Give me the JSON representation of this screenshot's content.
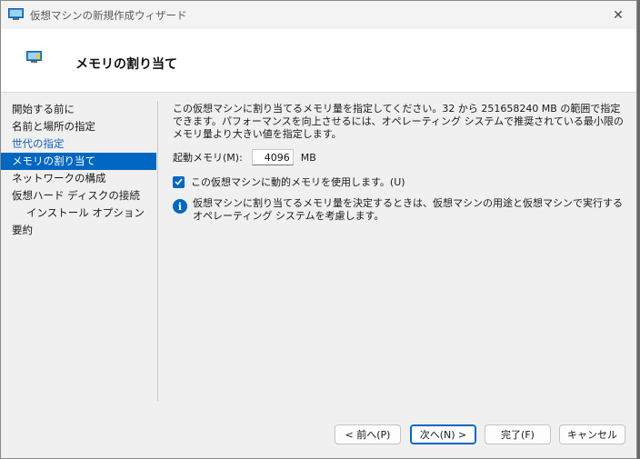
{
  "window": {
    "title": "仮想マシンの新規作成ウィザード",
    "close_glyph": "✕"
  },
  "header": {
    "title": "メモリの割り当て"
  },
  "nav": {
    "items": [
      {
        "label": "開始する前に"
      },
      {
        "label": "名前と場所の指定"
      },
      {
        "label": "世代の指定"
      },
      {
        "label": "メモリの割り当て"
      },
      {
        "label": "ネットワークの構成"
      },
      {
        "label": "仮想ハード ディスクの接続"
      },
      {
        "label": "インストール オプション"
      },
      {
        "label": "要約"
      }
    ],
    "active_index": 3
  },
  "main": {
    "description": "この仮想マシンに割り当てるメモリ量を指定してください。32 から 251658240 MB の範囲で指定できます。パフォーマンスを向上させるには、オペレーティング システムで推奨されている最小限のメモリ量より大きい値を指定します。",
    "startup_memory_label": "起動メモリ(M):",
    "startup_memory_value": "4096",
    "memory_unit": "MB",
    "dynamic_memory_label": "この仮想マシンに動的メモリを使用します。(U)",
    "dynamic_memory_checked": true,
    "info_text": "仮想マシンに割り当てるメモリ量を決定するときは、仮想マシンの用途と仮想マシンで実行するオペレーティング システムを考慮します。",
    "info_icon": "info-icon"
  },
  "buttons": {
    "prev": "< 前へ(P)",
    "next": "次へ(N) >",
    "finish": "完了(F)",
    "cancel": "キャンセル"
  },
  "colors": {
    "accent": "#0067c0",
    "link": "#1560bd"
  }
}
